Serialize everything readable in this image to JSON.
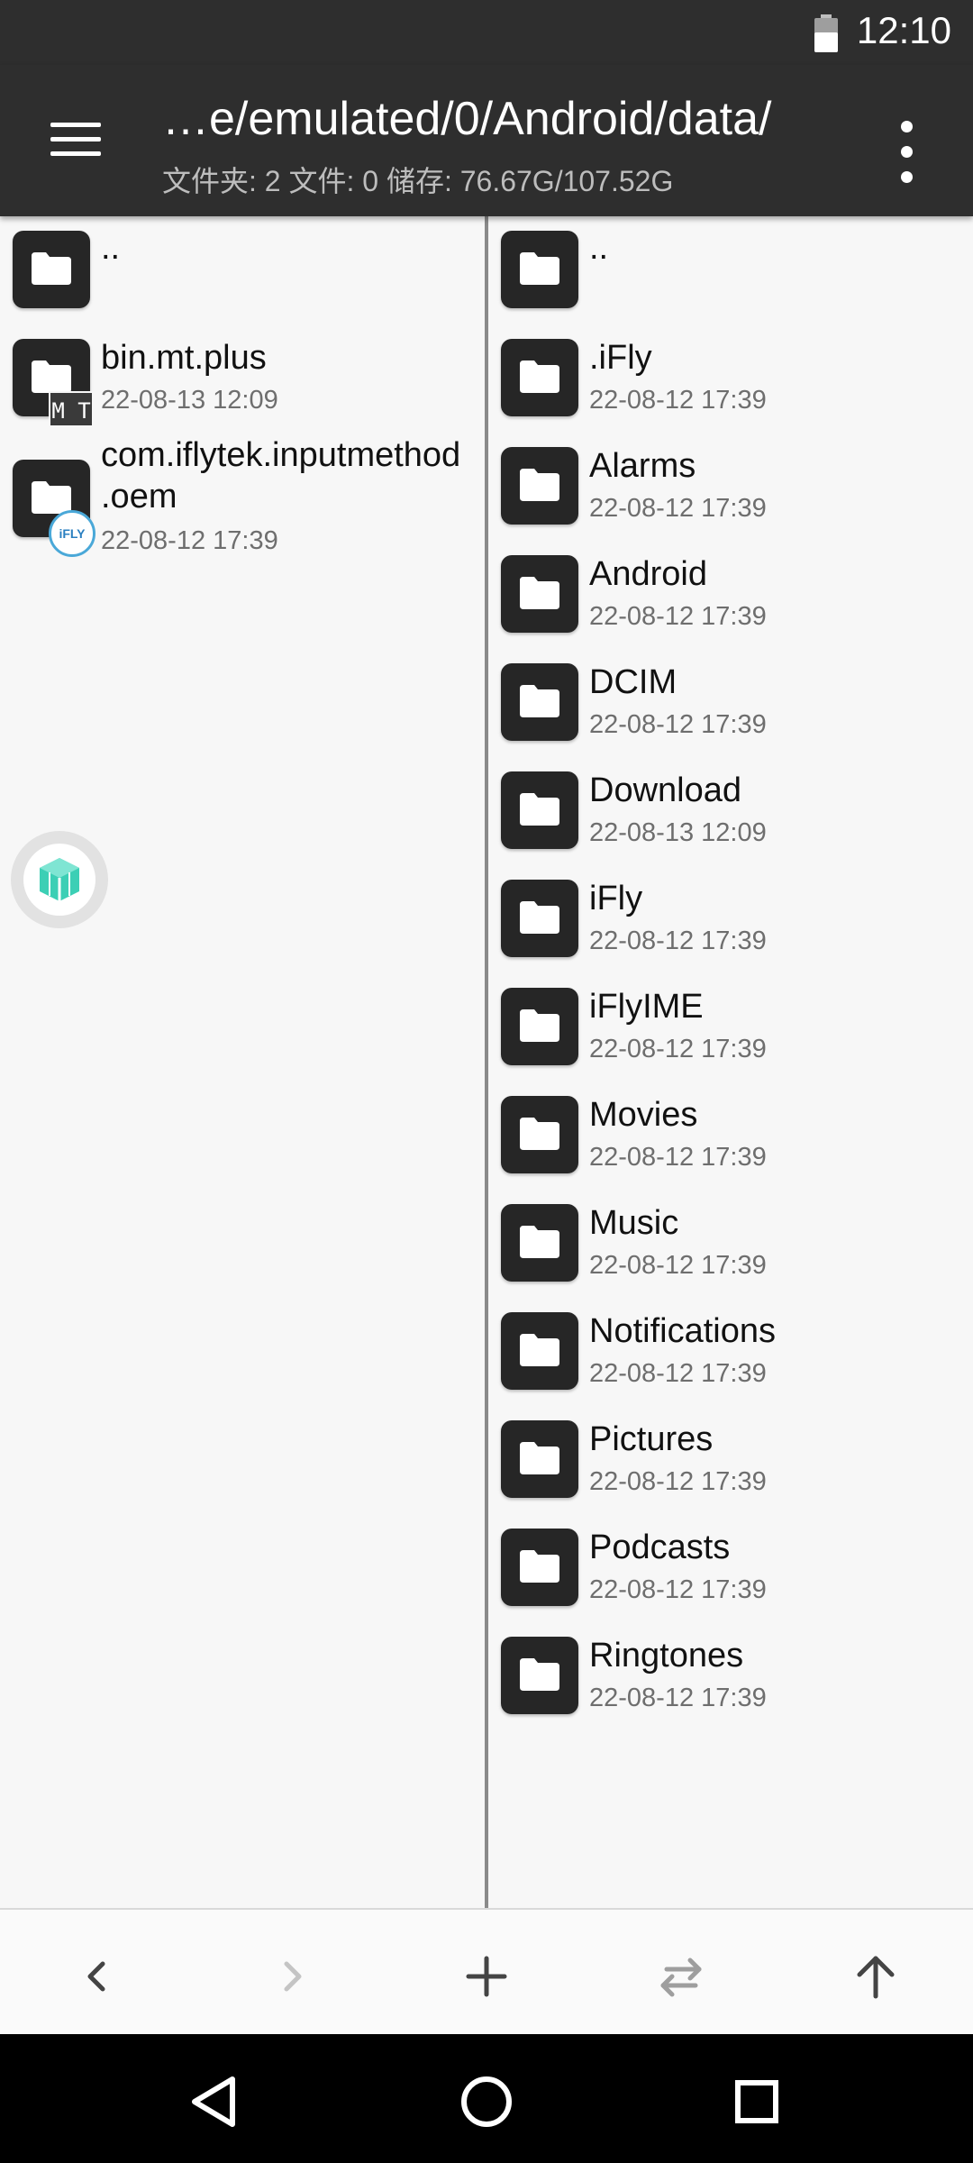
{
  "status_bar": {
    "time": "12:10"
  },
  "app_bar": {
    "path": "…e/emulated/0/Android/data/",
    "stats": "文件夹: 2  文件: 0  储存: 76.67G/107.52G"
  },
  "left_pane": {
    "parent": "..",
    "items": [
      {
        "name": "bin.mt.plus",
        "date": "22-08-13 12:09",
        "badge": "M T"
      },
      {
        "name_line1": "com.iflytek.inputmethod",
        "name_line2": ".oem",
        "date": "22-08-12 17:39",
        "badge": "iFLY"
      }
    ]
  },
  "right_pane": {
    "parent": "..",
    "items": [
      {
        "name": ".iFly",
        "date": "22-08-12 17:39"
      },
      {
        "name": "Alarms",
        "date": "22-08-12 17:39"
      },
      {
        "name": "Android",
        "date": "22-08-12 17:39"
      },
      {
        "name": "DCIM",
        "date": "22-08-12 17:39"
      },
      {
        "name": "Download",
        "date": "22-08-13 12:09"
      },
      {
        "name": "iFly",
        "date": "22-08-12 17:39"
      },
      {
        "name": "iFlyIME",
        "date": "22-08-12 17:39"
      },
      {
        "name": "Movies",
        "date": "22-08-12 17:39"
      },
      {
        "name": "Music",
        "date": "22-08-12 17:39"
      },
      {
        "name": "Notifications",
        "date": "22-08-12 17:39"
      },
      {
        "name": "Pictures",
        "date": "22-08-12 17:39"
      },
      {
        "name": "Podcasts",
        "date": "22-08-12 17:39"
      },
      {
        "name": "Ringtones",
        "date": "22-08-12 17:39"
      }
    ]
  },
  "colors": {
    "app_bar_bg": "#2e2e2e",
    "pane_bg": "#f7f7f7",
    "folder_icon_bg": "#262626",
    "accent_teal": "#3ccfb5"
  }
}
